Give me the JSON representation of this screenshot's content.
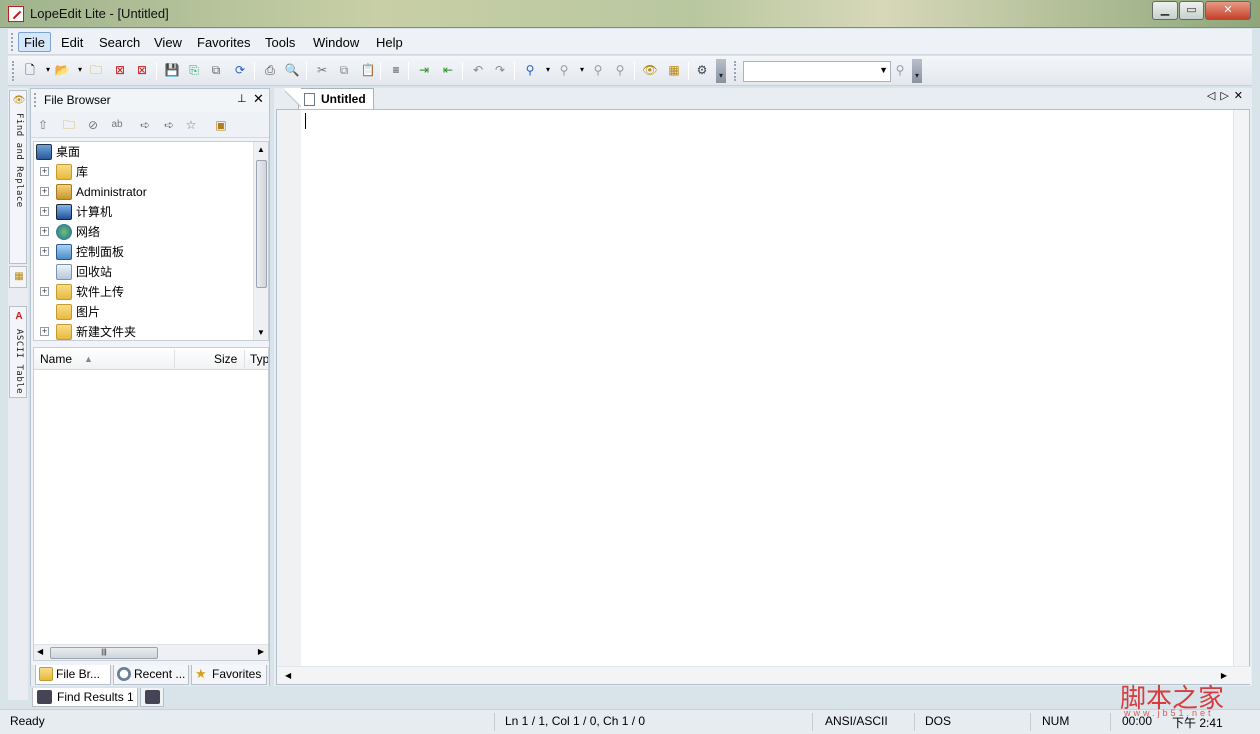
{
  "window": {
    "title": "LopeEdit Lite - [Untitled]",
    "minimize": "▁",
    "restore": "▭",
    "close": "✕"
  },
  "menu": {
    "file": "File",
    "edit": "Edit",
    "search": "Search",
    "view": "View",
    "favorites": "Favorites",
    "tools": "Tools",
    "window": "Window",
    "help": "Help"
  },
  "toolbar": {
    "search_combo_value": ""
  },
  "left_tabs": {
    "find_replace": "Find and Replace",
    "ascii_table": "ASCII Table"
  },
  "file_browser": {
    "title": "File Browser",
    "pin": "📌",
    "close": "✕",
    "tree": [
      {
        "label": "桌面",
        "expandable": false
      },
      {
        "label": "库",
        "expandable": true
      },
      {
        "label": "Administrator",
        "expandable": true
      },
      {
        "label": "计算机",
        "expandable": true
      },
      {
        "label": "网络",
        "expandable": true
      },
      {
        "label": "控制面板",
        "expandable": true
      },
      {
        "label": "回收站",
        "expandable": false
      },
      {
        "label": "软件上传",
        "expandable": true
      },
      {
        "label": "图片",
        "expandable": false
      },
      {
        "label": "新建文件夹",
        "expandable": true
      }
    ],
    "columns": {
      "name": "Name",
      "size": "Size",
      "type": "Typ"
    },
    "tabs": {
      "file_browser": "File Br...",
      "recent": "Recent ...",
      "favorites": "Favorites"
    }
  },
  "editor": {
    "tab_label": "Untitled"
  },
  "bottom": {
    "find_results": "Find Results 1"
  },
  "status": {
    "ready": "Ready",
    "position": "Ln 1 / 1, Col 1 / 0, Ch 1 / 0",
    "encoding": "ANSI/ASCII",
    "line_endings": "DOS",
    "num": "NUM",
    "elapsed": "00:00",
    "clock": "下午 2:41"
  },
  "watermark": {
    "main": "脚本之家",
    "sub": "www.jb51.net"
  }
}
